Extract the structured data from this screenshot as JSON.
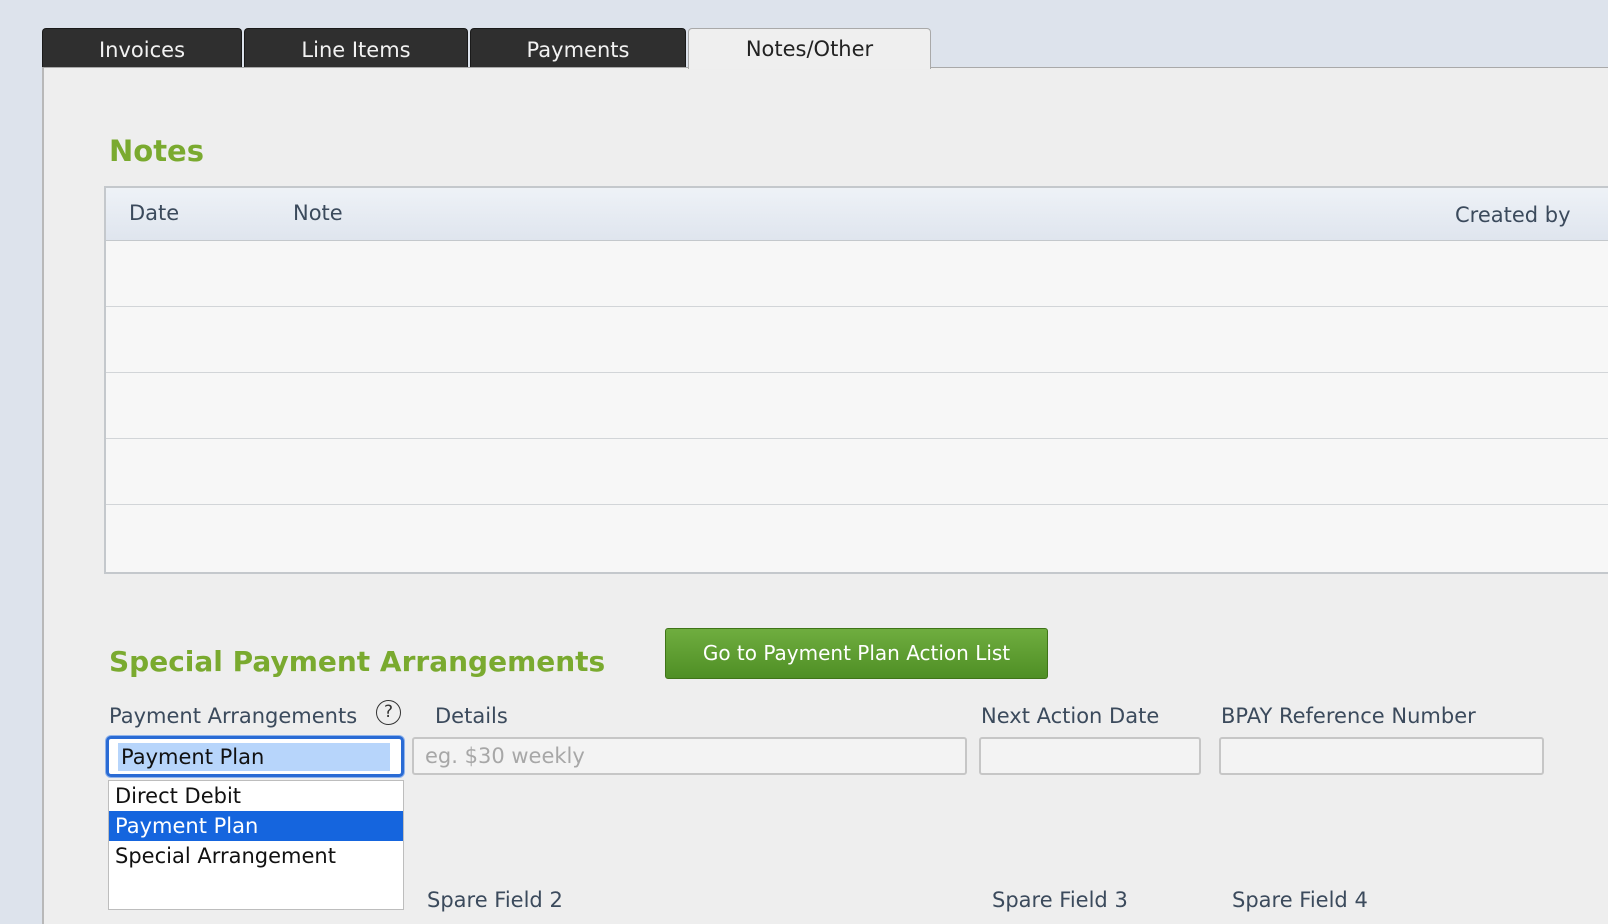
{
  "tabs": [
    {
      "label": "Invoices"
    },
    {
      "label": "Line Items"
    },
    {
      "label": "Payments"
    },
    {
      "label": "Notes/Other",
      "active": true
    }
  ],
  "notes": {
    "title": "Notes",
    "columns": {
      "date": "Date",
      "note": "Note",
      "created_by": "Created by"
    },
    "rows": []
  },
  "arrangements": {
    "title": "Special Payment Arrangements",
    "action_button": "Go to Payment Plan Action List",
    "labels": {
      "payment_arrangements": "Payment Arrangements",
      "details": "Details",
      "next_action_date": "Next Action Date",
      "bpay_reference": "BPAY Reference Number"
    },
    "help_icon": "?",
    "select_value": "Payment Plan",
    "options": [
      "Direct Debit",
      "Payment Plan",
      "Special Arrangement"
    ],
    "selected_option": "Payment Plan",
    "details_placeholder": "eg. $30 weekly",
    "details_value": "",
    "next_action_date_value": "",
    "bpay_value": ""
  },
  "spare_fields": {
    "spare2": "Spare Field 2",
    "spare3": "Spare Field 3",
    "spare4": "Spare Field 4"
  },
  "colors": {
    "accent_green": "#7aaa2f",
    "button_green": "#5e9e30",
    "focus_blue": "#2a6bd4",
    "selected_blue": "#1565de",
    "tab_dark": "#2f2f2f"
  }
}
